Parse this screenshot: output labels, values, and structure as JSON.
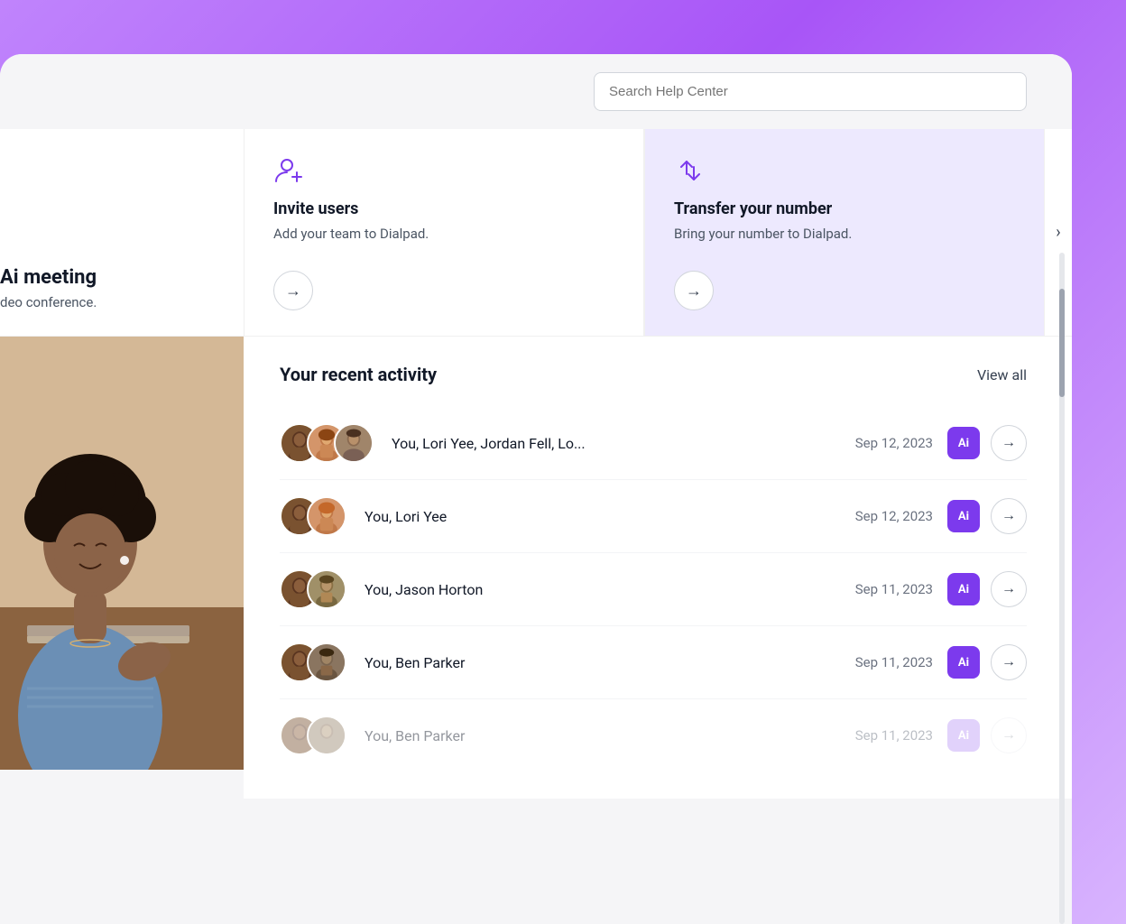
{
  "background_gradient": "linear-gradient(135deg, #c084fc, #a855f7, #d8b4fe)",
  "search": {
    "placeholder": "Search Help Center"
  },
  "cards": [
    {
      "id": "ai-meeting",
      "title": "Ai meeting",
      "subtitle": "deo conference.",
      "partial": true,
      "bg": "white"
    },
    {
      "id": "invite-users",
      "title": "Invite users",
      "subtitle": "Add your team to Dialpad.",
      "partial": false,
      "bg": "white",
      "icon": "add-user"
    },
    {
      "id": "transfer-number",
      "title": "Transfer your number",
      "subtitle": "Bring your number to Dialpad.",
      "partial": false,
      "bg": "#ede9fe",
      "icon": "transfer"
    }
  ],
  "activity": {
    "section_title": "Your recent activity",
    "view_all_label": "View all",
    "items": [
      {
        "id": 1,
        "name": "You, Lori Yee, Jordan Fell, Lo...",
        "date": "Sep 12, 2023",
        "has_ai": true,
        "avatar_count": 3
      },
      {
        "id": 2,
        "name": "You, Lori Yee",
        "date": "Sep 12, 2023",
        "has_ai": true,
        "avatar_count": 2
      },
      {
        "id": 3,
        "name": "You, Jason Horton",
        "date": "Sep 11, 2023",
        "has_ai": true,
        "avatar_count": 2
      },
      {
        "id": 4,
        "name": "You, Ben Parker",
        "date": "Sep 11, 2023",
        "has_ai": true,
        "avatar_count": 2
      },
      {
        "id": 5,
        "name": "You, Ben Parker",
        "date": "Sep 11, 2023",
        "has_ai": true,
        "avatar_count": 2,
        "partial": true
      }
    ]
  },
  "ai_badge_label": "Ai",
  "arrow_symbol": "→"
}
